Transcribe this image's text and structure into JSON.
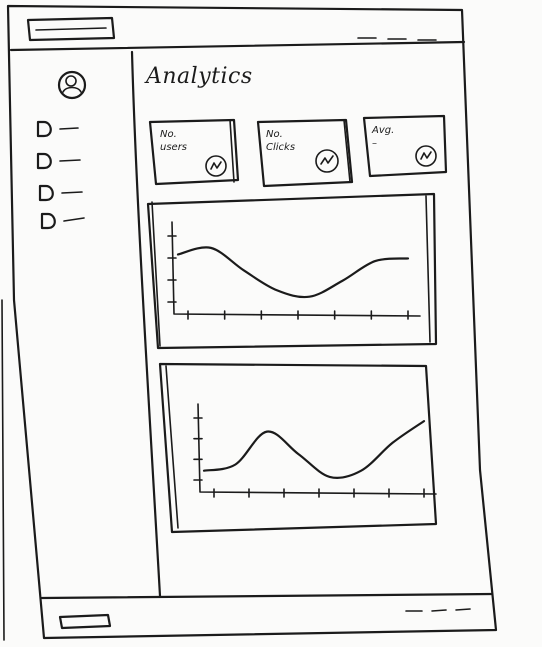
{
  "page": {
    "title": "Analytics"
  },
  "stat_cards": [
    {
      "label": "No.\nusers",
      "icon": "chart-icon"
    },
    {
      "label": "No.\nClicks",
      "icon": "chart-icon"
    },
    {
      "label": "Avg.\n–",
      "icon": "chart-icon"
    }
  ],
  "sidebar": {
    "avatar_icon": "user-avatar-icon",
    "items": [
      {
        "icon": "document-icon"
      },
      {
        "icon": "document-icon"
      },
      {
        "icon": "document-icon"
      },
      {
        "icon": "document-icon"
      }
    ]
  },
  "chart_data": [
    {
      "type": "line",
      "title": "",
      "xlabel": "",
      "ylabel": "",
      "x": [
        0,
        1,
        2,
        3,
        4,
        5,
        6,
        7
      ],
      "series": [
        {
          "values": [
            0.72,
            0.82,
            0.48,
            0.18,
            0.08,
            0.32,
            0.62,
            0.66
          ]
        }
      ],
      "ylim": [
        0,
        1
      ],
      "grid": false
    },
    {
      "type": "line",
      "title": "",
      "xlabel": "",
      "ylabel": "",
      "x": [
        0,
        1,
        2,
        3,
        4,
        5,
        6,
        7
      ],
      "series": [
        {
          "values": [
            0.15,
            0.25,
            0.78,
            0.42,
            0.05,
            0.15,
            0.6,
            0.95
          ]
        }
      ],
      "ylim": [
        0,
        1
      ],
      "grid": false
    }
  ]
}
